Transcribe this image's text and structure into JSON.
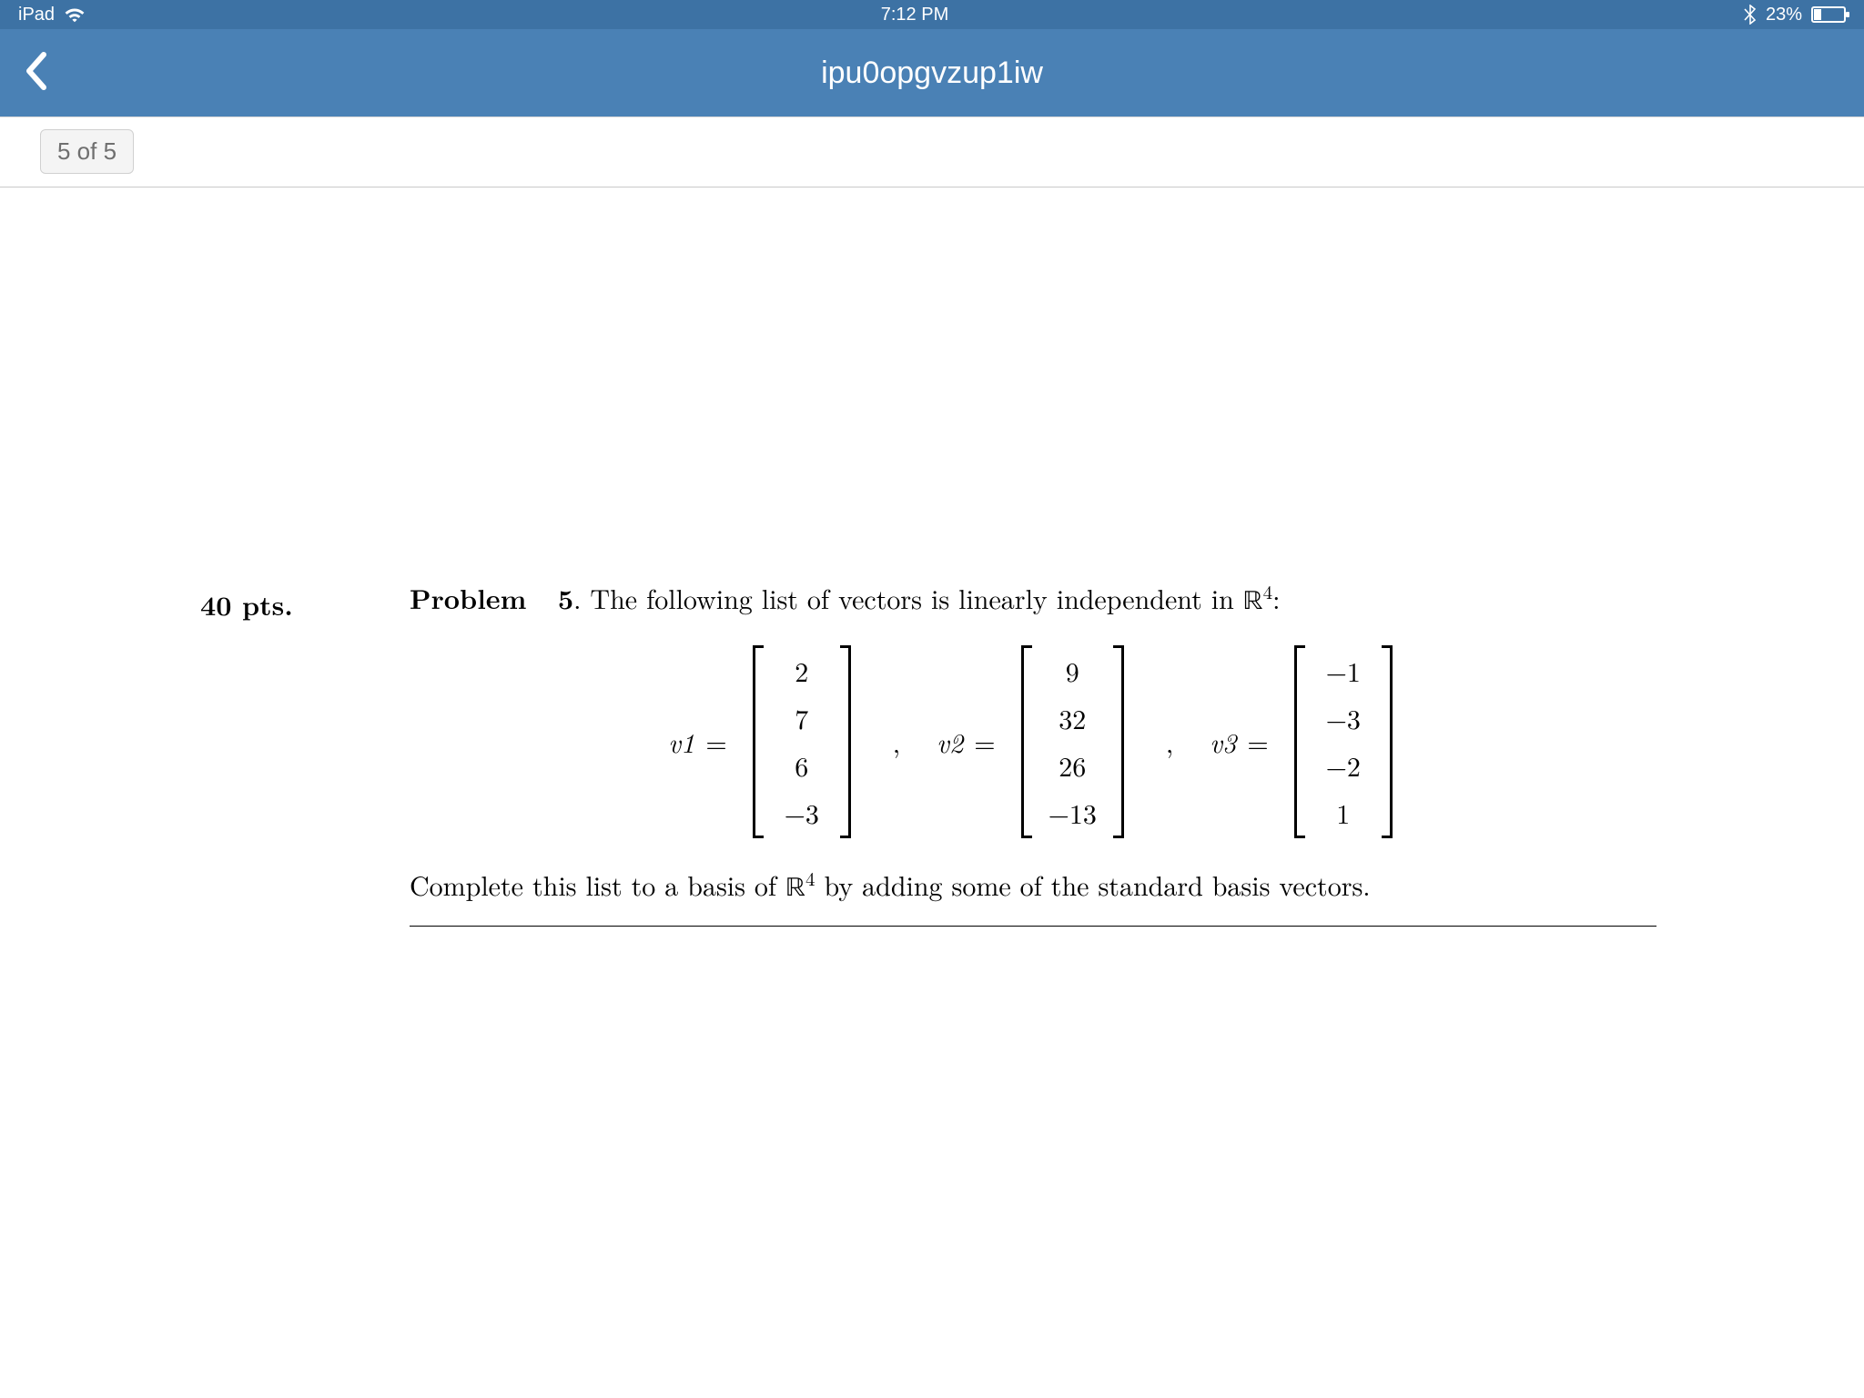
{
  "status": {
    "device": "iPad",
    "time": "7:12 PM",
    "battery_pct": "23%"
  },
  "nav": {
    "title": "ipu0opgvzup1iw"
  },
  "page_counter": "5 of 5",
  "problem": {
    "points": "40 pts.",
    "label": "Problem",
    "number": "5",
    "lead_after_number": ". The following list of vectors is linearly independent in ",
    "space": "ℝ",
    "space_sup": "4",
    "lead_end": ":",
    "v_labels": [
      "v1",
      "v2",
      "v3"
    ],
    "eq": "=",
    "comma": ",",
    "v1": [
      "2",
      "7",
      "6",
      "−3"
    ],
    "v2": [
      "9",
      "32",
      "26",
      "−13"
    ],
    "v3": [
      "−1",
      "−3",
      "−2",
      "1"
    ],
    "closing_a": "Complete this list to a basis of ",
    "closing_b": " by adding some of the standard basis vectors."
  }
}
